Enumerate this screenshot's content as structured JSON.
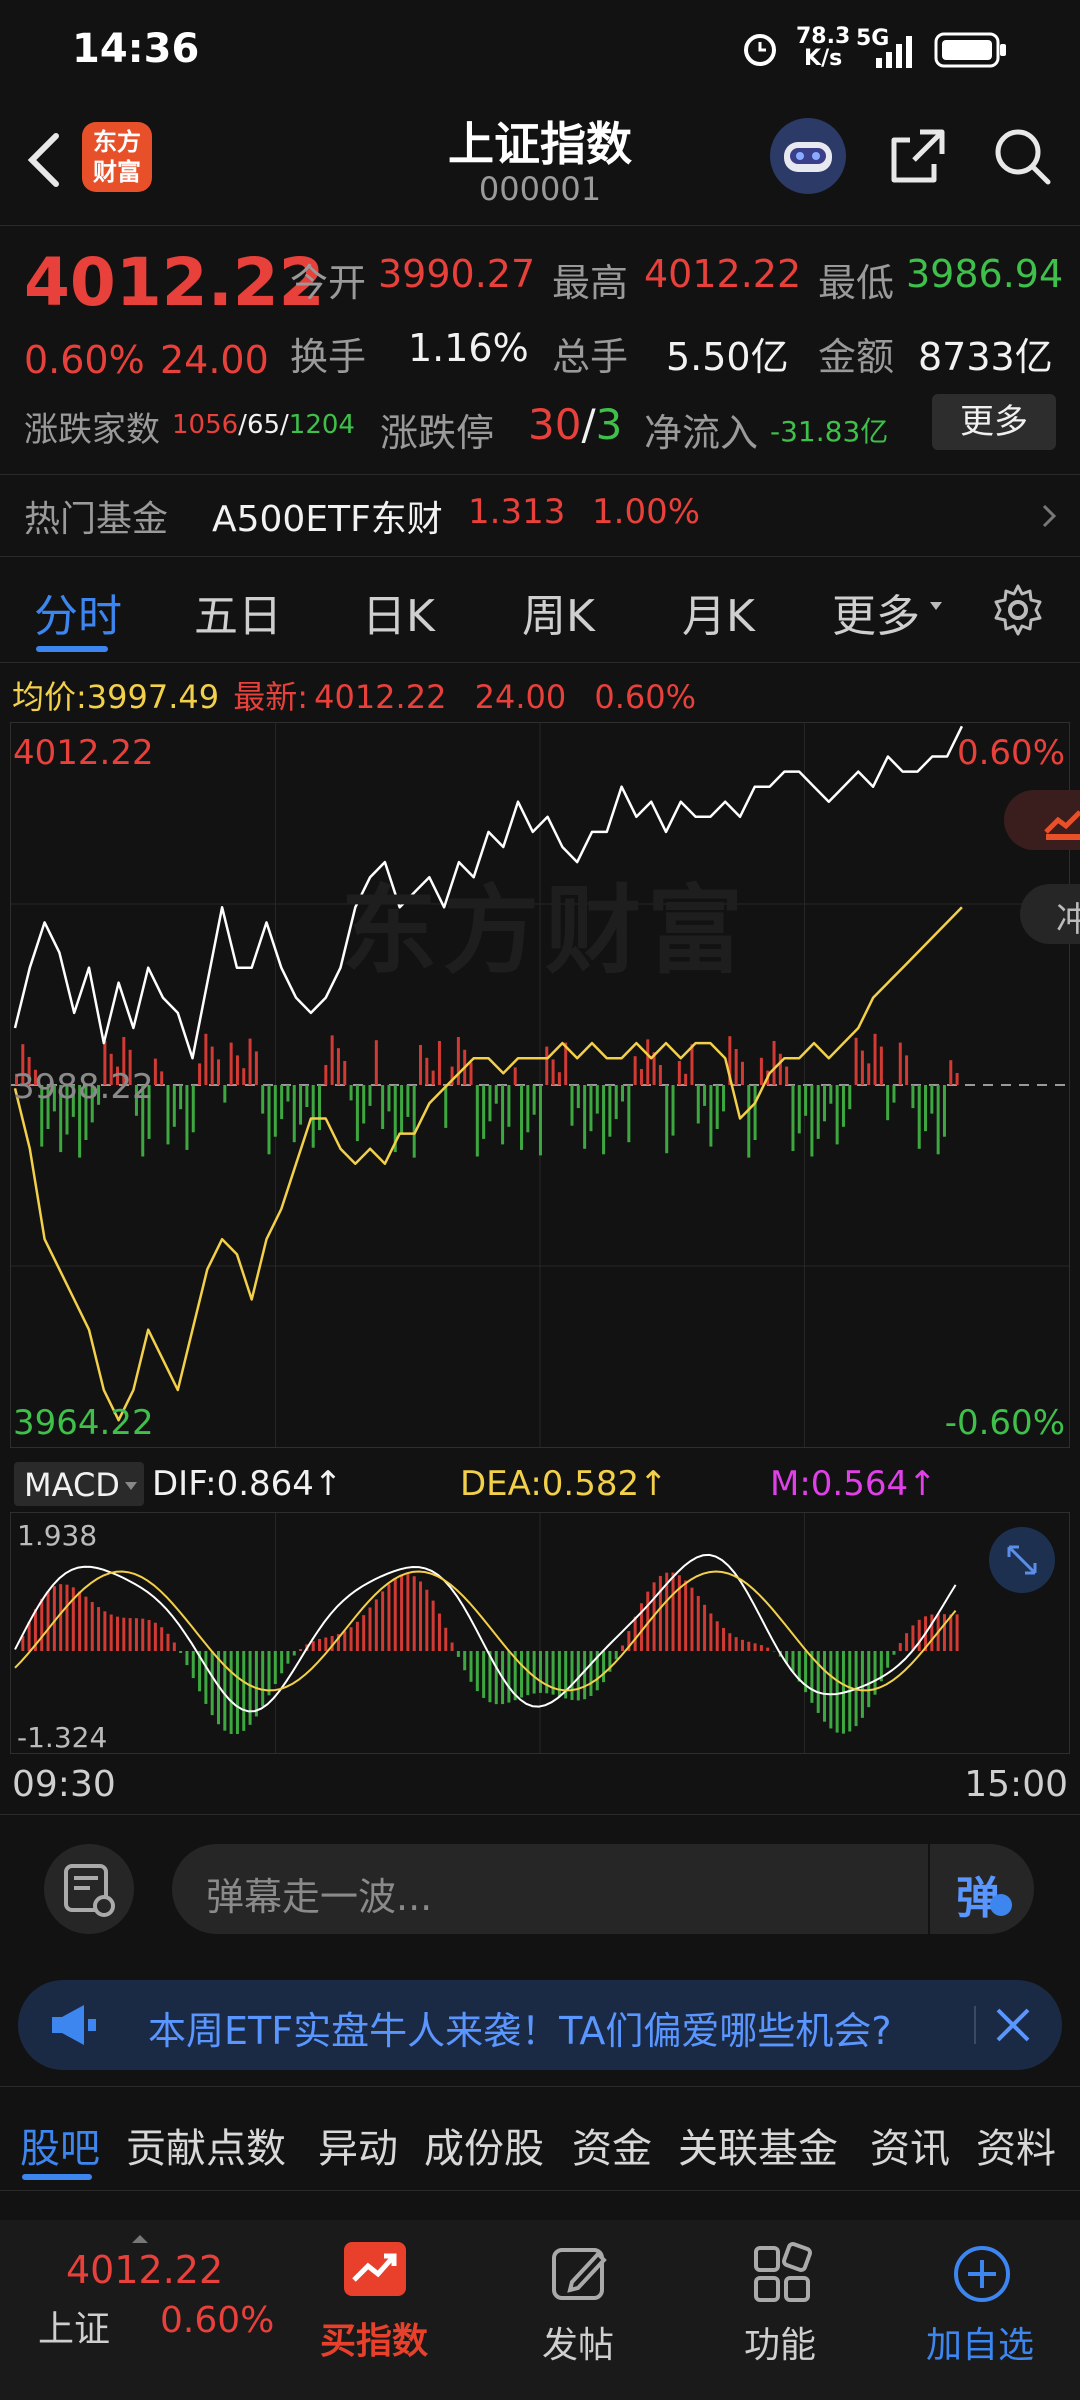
{
  "status": {
    "time": "14:36",
    "net_speed": "78.3",
    "net_unit": "K/s",
    "network": "5G"
  },
  "header": {
    "back_icon": "chevron-left-icon",
    "app_logo": "东方财富",
    "title": "上证指数",
    "code": "000001"
  },
  "quote": {
    "price": "4012.22",
    "pct": "0.60%",
    "change": "24.00",
    "open_label": "今开",
    "open": "3990.27",
    "high_label": "最高",
    "high": "4012.22",
    "low_label": "最低",
    "low": "3986.94",
    "turnover_label": "换手",
    "turnover": "1.16%",
    "volume_label": "总手",
    "volume": "5.50亿",
    "amount_label": "金额",
    "amount": "8733亿",
    "breadth_label": "涨跌家数",
    "up": "1056",
    "flat": "65",
    "down": "1204",
    "limit_label": "涨跌停",
    "limit_up": "30",
    "limit_down": "3",
    "netflow_label": "净流入",
    "netflow": "-31.83亿",
    "more_button": "更多"
  },
  "hot_fund": {
    "label": "热门基金",
    "name": "A500ETF东财",
    "price": "1.313",
    "pct": "1.00%"
  },
  "tabs": [
    "分时",
    "五日",
    "日K",
    "周K",
    "月K",
    "更多"
  ],
  "info_line": {
    "avg_label": "均价:",
    "avg": "3997.49",
    "latest_label": "最新:",
    "latest": "4012.22",
    "change": "24.00",
    "pct": "0.60%"
  },
  "chart_data": {
    "type": "line",
    "watermark": "东方财富",
    "y_top": "4012.22",
    "y_mid": "3988.22",
    "y_bottom": "3964.22",
    "pct_top": "0.60%",
    "pct_bottom": "-0.60%",
    "ylim": [
      3964.22,
      4012.22
    ],
    "x_start": "09:30",
    "x_end": "15:00",
    "series": [
      {
        "values": [
          3992,
          3996,
          3999,
          3997,
          3993,
          3996,
          3991,
          3995,
          3992,
          3996,
          3994,
          3993,
          3990,
          3995,
          4000,
          3996,
          3996,
          3999,
          3996,
          3994,
          3993,
          3994,
          3996,
          4000,
          4002,
          4003,
          4000,
          4001,
          4002,
          4000,
          4003,
          4002,
          4005,
          4004,
          4007,
          4005,
          4006,
          4004,
          4003,
          4005,
          4005,
          4008,
          4006,
          4007,
          4005,
          4007,
          4006,
          4006,
          4007,
          4006,
          4008,
          4008,
          4009,
          4009,
          4008,
          4007,
          4008,
          4009,
          4008,
          4010,
          4009,
          4009,
          4010,
          4010,
          4012
        ]
      },
      {
        "values": [
          3988,
          3984,
          3978,
          3976,
          3974,
          3972,
          3968,
          3966,
          3968,
          3972,
          3970,
          3968,
          3972,
          3976,
          3978,
          3977,
          3974,
          3978,
          3980,
          3983,
          3986,
          3986,
          3984,
          3983,
          3984,
          3983,
          3985,
          3985,
          3987,
          3988,
          3989,
          3990,
          3990,
          3989,
          3990,
          3990,
          3990,
          3991,
          3990,
          3991,
          3990,
          3990,
          3991,
          3990,
          3991,
          3990,
          3991,
          3991,
          3990,
          3986,
          3987,
          3989,
          3990,
          3990,
          3991,
          3990,
          3991,
          3992,
          3994,
          3995,
          3996,
          3997,
          3998,
          3999,
          4000
        ]
      }
    ]
  },
  "macd": {
    "indicator": "MACD",
    "dif": "DIF:0.864↑",
    "dea": "DEA:0.582↑",
    "m": "M:0.564↑",
    "max": "1.938",
    "min": "-1.324",
    "expand_icon": "expand-icon"
  },
  "danmaku": {
    "placeholder": "弹幕走一波...",
    "button": "弹"
  },
  "banner": {
    "text": "本周ETF实盘牛人来袭！TA们偏爱哪些机会?"
  },
  "bottom_tabs": [
    "股吧",
    "贡献点数",
    "异动",
    "成份股",
    "资金",
    "关联基金",
    "资讯",
    "资料"
  ],
  "nav": {
    "index_price": "4012.22",
    "index_name": "上证",
    "index_pct": "0.60%",
    "buy": "买指数",
    "post": "发帖",
    "func": "功能",
    "add": "加自选"
  },
  "colors": {
    "up": "#e8403a",
    "down": "#3ec04a",
    "accent": "#3d86f0",
    "avg_line": "#f2d04a"
  }
}
